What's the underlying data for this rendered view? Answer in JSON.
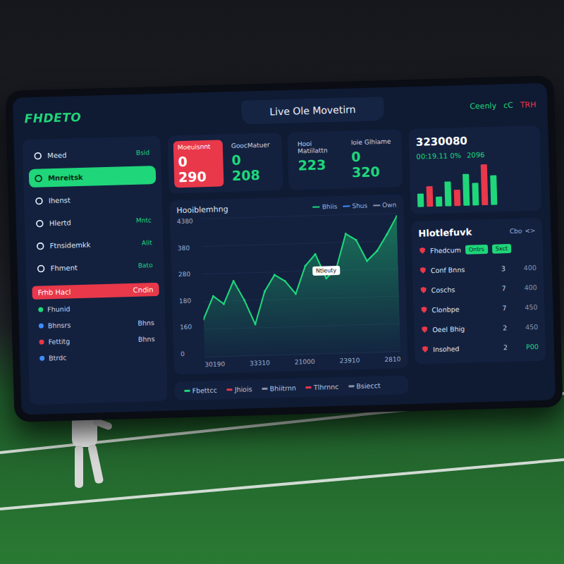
{
  "header": {
    "logo": "FHDETO",
    "title": "Live Ole Movetirn",
    "actions": [
      {
        "label": "Ceenly",
        "color": "#1fd67a"
      },
      {
        "label": "cC",
        "color": "#1fd67a"
      },
      {
        "label": "TRH",
        "color": "#e8384a"
      }
    ]
  },
  "sidebar": {
    "items": [
      {
        "label": "Meed",
        "value": "Bsid",
        "selected": false
      },
      {
        "label": "Mnreitsk",
        "value": "",
        "selected": true
      },
      {
        "label": "Ihenst",
        "value": "",
        "selected": false
      },
      {
        "label": "Hlertd",
        "value": "Mntc",
        "selected": false
      },
      {
        "label": "Ftnsidemkk",
        "value": "Alit",
        "selected": false
      },
      {
        "label": "Fhment",
        "value": "Bato",
        "selected": false
      }
    ],
    "alert": {
      "label": "Frhb Hacl",
      "value": "Cndin"
    },
    "matches": [
      {
        "label": "Fhunid",
        "value": "",
        "color": "#1fd67a"
      },
      {
        "label": "Bhnsrs",
        "value": "Bhns",
        "color": "#3f8cff"
      },
      {
        "label": "Fettitg",
        "value": "Bhns",
        "color": "#e8384a"
      },
      {
        "label": "Btrdc",
        "value": "",
        "color": "#3f8cff"
      }
    ]
  },
  "cards": [
    {
      "items": [
        {
          "label": "Moeuisnnt",
          "value": "0 290",
          "color": "#e8384a"
        },
        {
          "label": "GoocMatuer",
          "value": "0 208",
          "color": "#1fd67a"
        }
      ]
    },
    {
      "items": [
        {
          "label": "Hooi Matiilattn",
          "value": "223",
          "color": "#1fd67a"
        },
        {
          "label": "Ioie Glhiame",
          "value": "0 320",
          "color": "#1fd67a"
        }
      ]
    }
  ],
  "chart": {
    "title": "Hooiblemhng",
    "legend": [
      {
        "label": "Bhiis",
        "color": "#1fd67a"
      },
      {
        "label": "Shus",
        "color": "#3f8cff"
      },
      {
        "label": "Own",
        "color": "#8a93a8"
      }
    ],
    "y_ticks": [
      "4380",
      "380",
      "280",
      "180",
      "160",
      "0"
    ],
    "y_max": 420,
    "x_ticks": [
      "30190",
      "33310",
      "21000",
      "23910",
      "2810"
    ],
    "series": [
      {
        "name": "Bhiis",
        "color": "#1fd67a",
        "values": [
          120,
          190,
          165,
          235,
          175,
          100,
          200,
          250,
          230,
          190,
          275,
          310,
          235,
          265,
          370,
          350,
          285,
          315,
          365,
          420
        ]
      }
    ],
    "tooltip": {
      "label": "Ntleuty",
      "index": 12
    }
  },
  "legend_strip": [
    {
      "label": "Fbettcc",
      "color": "#1fd67a"
    },
    {
      "label": "Jhiois",
      "color": "#e8384a"
    },
    {
      "label": "Bhiitrnn",
      "color": "#8a93a8"
    },
    {
      "label": "Tlhrnnc",
      "color": "#e8384a"
    },
    {
      "label": "Bsiecct",
      "color": "#8a93a8"
    }
  ],
  "stat": {
    "total": "3230080",
    "sub": "00:19.11 0%",
    "change": "2096",
    "bars": [
      {
        "value": 30,
        "color": "#1fd67a"
      },
      {
        "value": 45,
        "color": "#e8384a"
      },
      {
        "value": 22,
        "color": "#1fd67a"
      },
      {
        "value": 55,
        "color": "#1fd67a"
      },
      {
        "value": 35,
        "color": "#e8384a"
      },
      {
        "value": 70,
        "color": "#1fd67a"
      },
      {
        "value": 50,
        "color": "#1fd67a"
      },
      {
        "value": 90,
        "color": "#e8384a"
      },
      {
        "value": 65,
        "color": "#1fd67a"
      }
    ]
  },
  "hotlist": {
    "title": "Hlotlefuvk",
    "filters": [
      "Cbo",
      "<>"
    ],
    "rows": [
      {
        "name": "Fhedcum",
        "count": "",
        "odds": "",
        "badges": [
          "Ontrs",
          "Sxct"
        ],
        "color": "#8a93a8"
      },
      {
        "name": "Conf Bnns",
        "count": "3",
        "odds": "400",
        "badges": [],
        "color": "#8a93a8"
      },
      {
        "name": "Coschs",
        "count": "7",
        "odds": "400",
        "badges": [],
        "color": "#8a93a8"
      },
      {
        "name": "Clonbpe",
        "count": "7",
        "odds": "450",
        "badges": [],
        "color": "#8a93a8"
      },
      {
        "name": "Oeel Bhig",
        "count": "2",
        "odds": "450",
        "badges": [],
        "color": "#8a93a8"
      },
      {
        "name": "Insohed",
        "count": "2",
        "odds": "P00",
        "badges": [],
        "color": "#1fd67a"
      }
    ]
  }
}
